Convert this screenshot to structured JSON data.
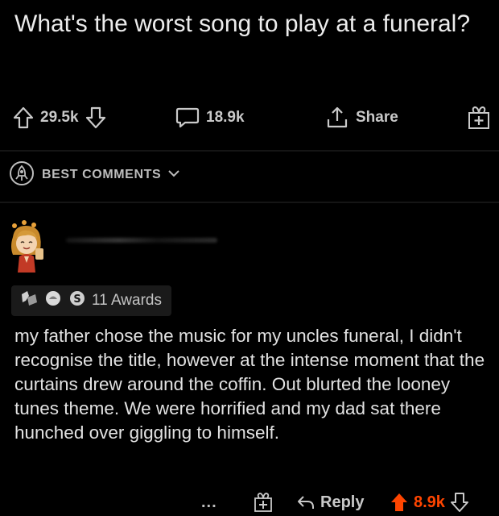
{
  "post": {
    "title": "What's the worst song to play at a funeral?",
    "upvotes": "29.5k",
    "comments": "18.9k",
    "share_label": "Share"
  },
  "sort": {
    "label": "BEST COMMENTS"
  },
  "comment": {
    "awards_label": "11 Awards",
    "body": "my father chose the music for my uncles funeral, I didn't recognise the title, however at the intense moment that the curtains drew around the coffin. Out blurted the looney tunes theme. We were horrified and my dad sat there hunched over giggling to himself.",
    "more_label": "...",
    "reply_label": "Reply",
    "votes": "8.9k"
  },
  "colors": {
    "background": "#000000",
    "text": "#e2e2e2",
    "muted": "#c9c9c9",
    "upvote_active": "#ff4500",
    "award_chip": "#1a1a1a"
  },
  "icons": {
    "upvote": "arrow-up-outline-icon",
    "downvote": "arrow-down-outline-icon",
    "comments": "speech-bubble-icon",
    "share": "share-upload-icon",
    "award": "gift-award-icon",
    "sort": "rocket-badge-icon",
    "chevron": "chevron-down-icon",
    "reply": "reply-arrow-icon",
    "upvote_active": "arrow-up-filled-icon"
  }
}
